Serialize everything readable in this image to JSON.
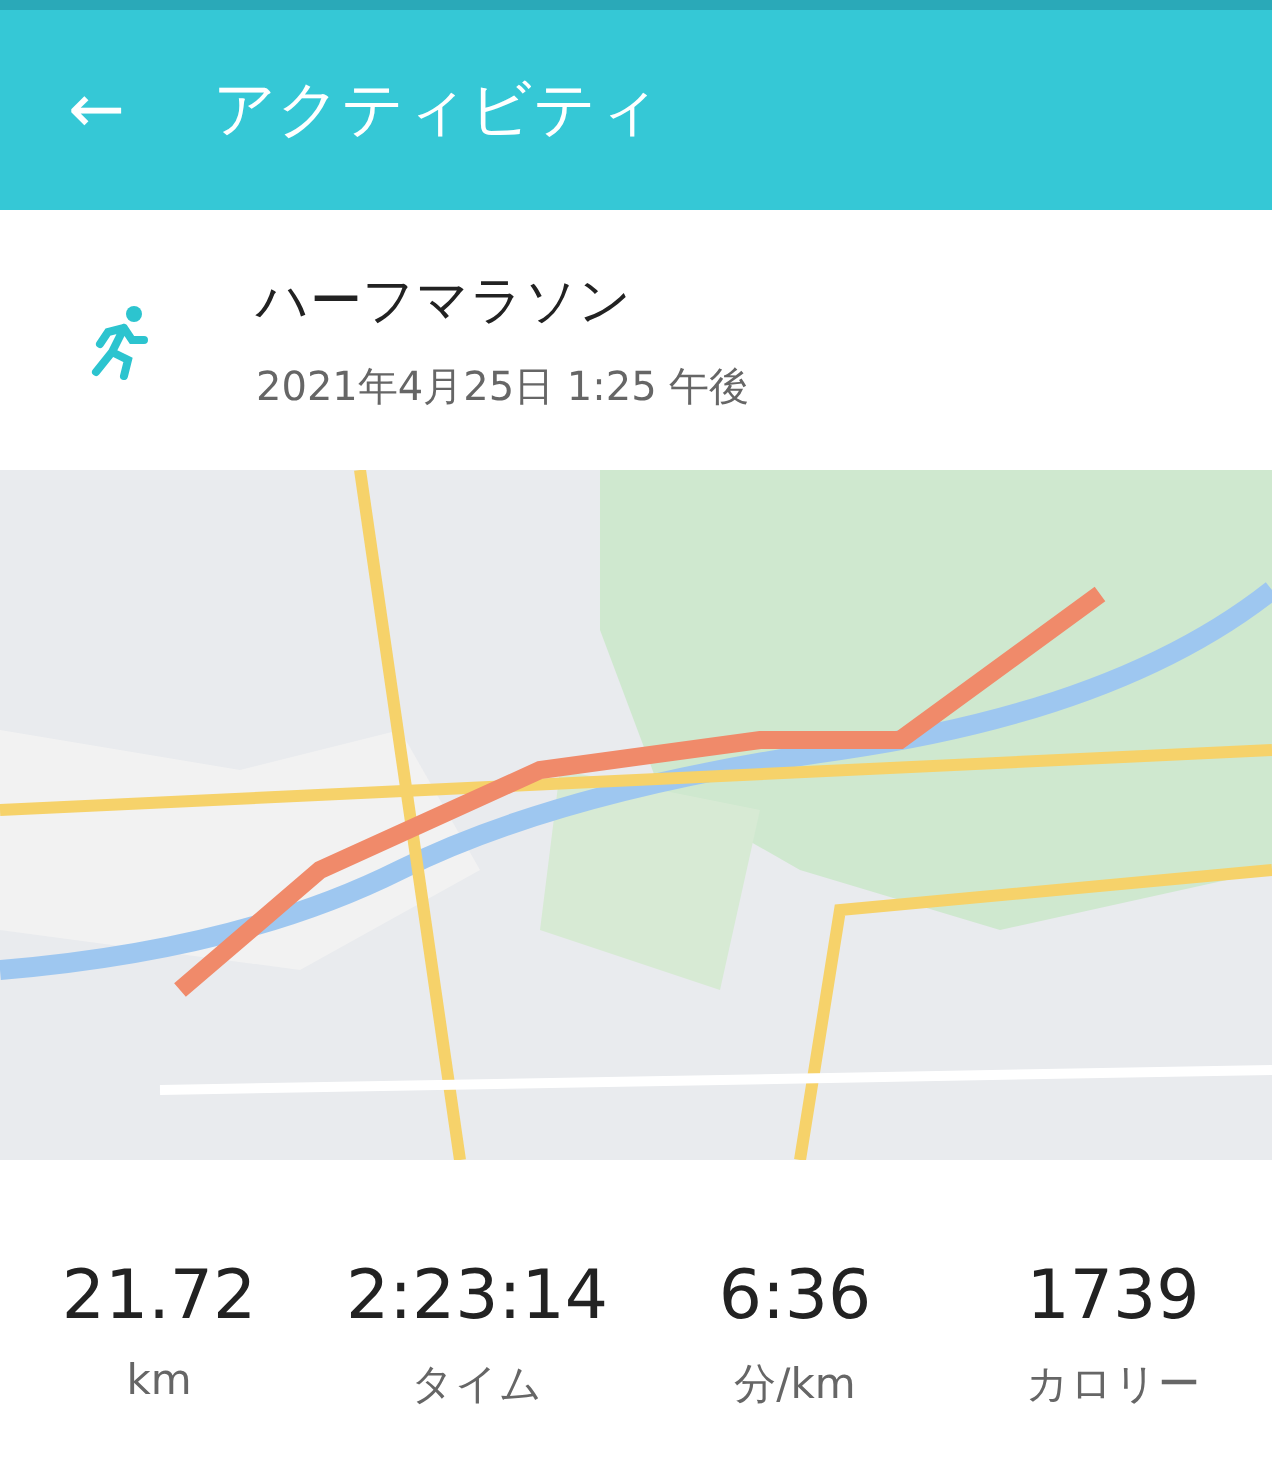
{
  "header": {
    "back": "←",
    "title": "アクティビティ"
  },
  "activity": {
    "name": "ハーフマラソン",
    "date": "2021年4月25日 1:25 午後"
  },
  "stats": [
    {
      "value": "21.72",
      "label": "km"
    },
    {
      "value": "2:23:14",
      "label": "タイム"
    },
    {
      "value": "6:36",
      "label": "分/km"
    },
    {
      "value": "1739",
      "label": "カロリー"
    }
  ]
}
